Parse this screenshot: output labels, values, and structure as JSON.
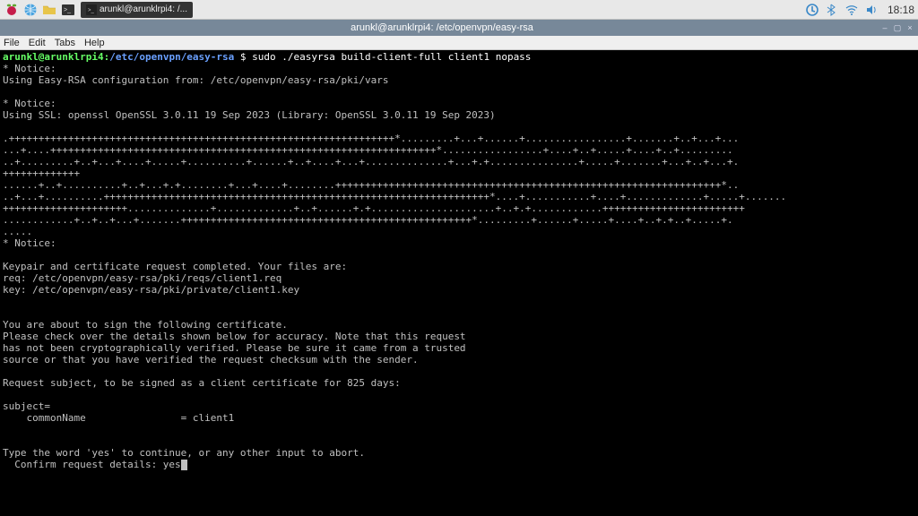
{
  "panel": {
    "taskbar_label": "arunkl@arunklrpi4: /...",
    "clock": "18:18"
  },
  "titlebar": {
    "title": "arunkl@arunklrpi4: /etc/openvpn/easy-rsa"
  },
  "menubar": {
    "file": "File",
    "edit": "Edit",
    "tabs": "Tabs",
    "help": "Help"
  },
  "prompt": {
    "userhost": "arunkl@arunklrpi4",
    "sep": ":",
    "path": "/etc/openvpn/easy-rsa",
    "dollar": " $ ",
    "command": "sudo ./easyrsa build-client-full client1 nopass"
  },
  "output": {
    "l01": "* Notice:",
    "l02": "Using Easy-RSA configuration from: /etc/openvpn/easy-rsa/pki/vars",
    "l03": "",
    "l04": "* Notice:",
    "l05": "Using SSL: openssl OpenSSL 3.0.11 19 Sep 2023 (Library: OpenSSL 3.0.11 19 Sep 2023)",
    "l06": "",
    "l07": ".+++++++++++++++++++++++++++++++++++++++++++++++++++++++++++++++++*.........+...+......+.................+.......+..+...+...",
    "l08": "...+....+++++++++++++++++++++++++++++++++++++++++++++++++++++++++++++++++*.................+....+..+.....+....+..+.........",
    "l09": "..+.........+..+...+....+.....+..........+......+..+....+...+..............+...+.+...............+.....+.......+...+..+...+.",
    "l10": "+++++++++++++",
    "l11": "......+..+..........+..+...+.+........+...+....+........+++++++++++++++++++++++++++++++++++++++++++++++++++++++++++++++++*..",
    "l12": "..+...+..........+++++++++++++++++++++++++++++++++++++++++++++++++++++++++++++++++*....+...........+....+.............+.....+.......",
    "l13": "+++++++++++++++++++++..............+.............+..+......+.+.....................+..+.+............++++++++++++++++++++++++",
    "l14": "............+..+..+...+.......+++++++++++++++++++++++++++++++++++++++++++++++++*.........+......+.....+....+..+.+..+.....+.",
    "l15": ".....",
    "l16": "* Notice:",
    "l17": "",
    "l18": "Keypair and certificate request completed. Your files are:",
    "l19": "req: /etc/openvpn/easy-rsa/pki/reqs/client1.req",
    "l20": "key: /etc/openvpn/easy-rsa/pki/private/client1.key",
    "l21": "",
    "l22": "",
    "l23": "You are about to sign the following certificate.",
    "l24": "Please check over the details shown below for accuracy. Note that this request",
    "l25": "has not been cryptographically verified. Please be sure it came from a trusted",
    "l26": "source or that you have verified the request checksum with the sender.",
    "l27": "",
    "l28": "Request subject, to be signed as a client certificate for 825 days:",
    "l29": "",
    "l30": "subject=",
    "l31": "    commonName                = client1",
    "l32": "",
    "l33": "",
    "l34": "Type the word 'yes' to continue, or any other input to abort.",
    "l35": "  Confirm request details: yes"
  }
}
